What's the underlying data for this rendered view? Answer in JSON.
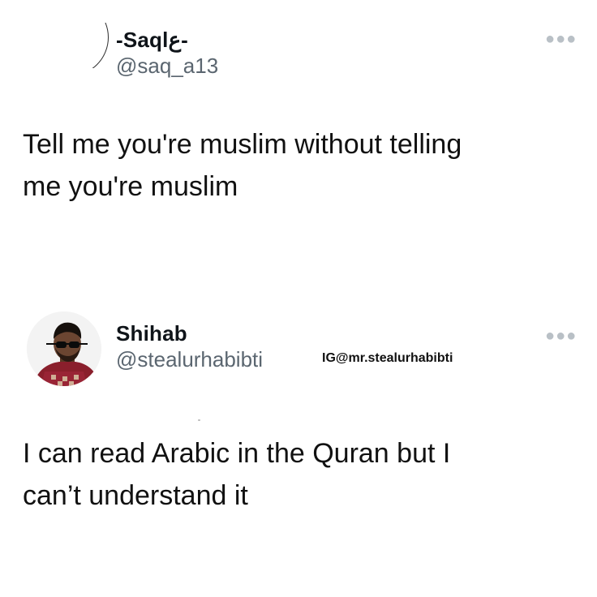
{
  "tweets": [
    {
      "display_name": "-Saqlع-",
      "handle": "@saq_a13",
      "text": "Tell me you're muslim without telling\nme you're muslim",
      "more_icon": "more-options-icon"
    },
    {
      "display_name": "Shihab",
      "handle": "@stealurhabibti",
      "watermark": "IG@mr.stealurhabibti",
      "text": "I can read Arabic in the Quran but I\ncan’t understand it",
      "more_icon": "more-options-icon"
    }
  ]
}
